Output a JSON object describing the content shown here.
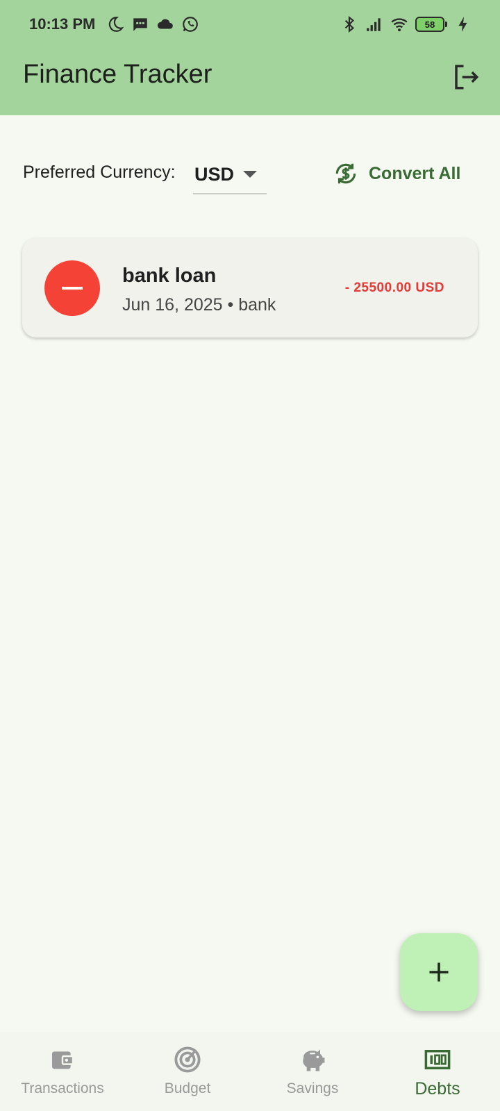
{
  "status_bar": {
    "time": "10:13 PM",
    "battery": "58"
  },
  "app_bar": {
    "title": "Finance Tracker"
  },
  "currency": {
    "label": "Preferred Currency:",
    "selected": "USD",
    "convert_label": "Convert All"
  },
  "debts": [
    {
      "name": "bank loan",
      "subtitle": "Jun 16, 2025 • bank",
      "amount": "- 25500.00 USD"
    }
  ],
  "bottom_nav": {
    "items": [
      {
        "label": "Transactions",
        "icon": "wallet-icon"
      },
      {
        "label": "Budget",
        "icon": "target-icon"
      },
      {
        "label": "Savings",
        "icon": "piggy-bank-icon"
      },
      {
        "label": "Debts",
        "icon": "money-icon"
      }
    ],
    "active": "Debts"
  },
  "colors": {
    "app_bar": "#a3d49b",
    "accent": "#3a6b34",
    "debt_red": "#f44336",
    "fab": "#bff0b6"
  }
}
